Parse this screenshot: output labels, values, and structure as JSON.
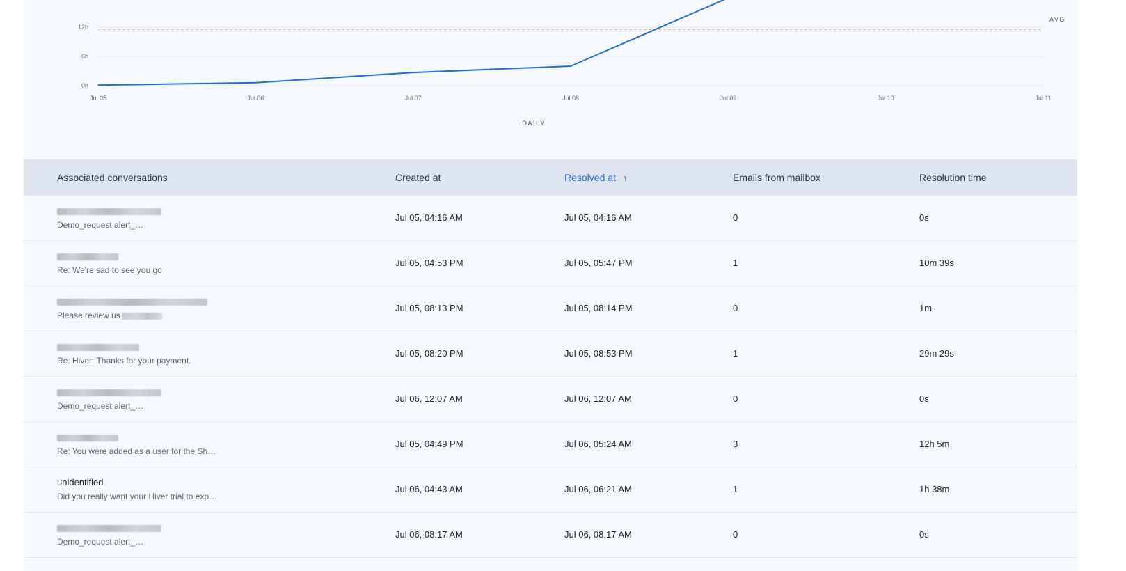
{
  "chart_data": {
    "type": "line",
    "title": "",
    "xlabel": "DAILY",
    "ylabel": "",
    "x_ticks": [
      "Jul 05",
      "Jul 06",
      "Jul 07",
      "Jul 08",
      "Jul 09",
      "Jul 10",
      "Jul 11"
    ],
    "y_ticks": [
      "0h",
      "6h",
      "12h"
    ],
    "ylim": [
      0,
      12
    ],
    "series": [
      {
        "points": [
          {
            "x": "Jul 05",
            "y": 0.1
          },
          {
            "x": "Jul 06",
            "y": 0.6
          },
          {
            "x": "Jul 07",
            "y": 2.7
          },
          {
            "x": "Jul 08",
            "y": 4.0
          },
          {
            "x": "Jul 09",
            "y": 18.0
          }
        ],
        "color": "#1e6fd6"
      }
    ],
    "avg": {
      "label": "AVG",
      "value": 11.5,
      "color": "#f2b483"
    },
    "grid": true
  },
  "table": {
    "columns": [
      {
        "label": "Associated conversations"
      },
      {
        "label": "Created at"
      },
      {
        "label": "Resolved at",
        "sort_arrow": "↑"
      },
      {
        "label": "Emails from mailbox"
      },
      {
        "label": "Resolution time"
      }
    ],
    "rows": [
      {
        "title": "",
        "subject": "Demo_request alert_",
        "created": "Jul 05, 04:16 AM",
        "resolved": "Jul 05, 04:16 AM",
        "emails": "0",
        "resolution": "0s"
      },
      {
        "title": "",
        "subject": "Re: We're sad to see you go",
        "created": "Jul 05, 04:53 PM",
        "resolved": "Jul 05, 05:47 PM",
        "emails": "1",
        "resolution": "10m 39s"
      },
      {
        "title": "",
        "subject": "Please review us",
        "created": "Jul 05, 08:13 PM",
        "resolved": "Jul 05, 08:14 PM",
        "emails": "0",
        "resolution": "1m"
      },
      {
        "title": "",
        "subject": "Re: Hiver: Thanks for your payment.",
        "created": "Jul 05, 08:20 PM",
        "resolved": "Jul 05, 08:53 PM",
        "emails": "1",
        "resolution": "29m 29s"
      },
      {
        "title": "",
        "subject": "Demo_request alert_",
        "created": "Jul 06, 12:07 AM",
        "resolved": "Jul 06, 12:07 AM",
        "emails": "0",
        "resolution": "0s"
      },
      {
        "title": "",
        "subject": "Re: You were added as a user for the Shar…",
        "created": "Jul 05, 04:49 PM",
        "resolved": "Jul 06, 05:24 AM",
        "emails": "3",
        "resolution": "12h 5m"
      },
      {
        "title": "unidentified",
        "subject": "Did you really want your Hiver trial to expi…",
        "created": "Jul 06, 04:43 AM",
        "resolved": "Jul 06, 06:21 AM",
        "emails": "1",
        "resolution": "1h 38m"
      },
      {
        "title": "",
        "subject": "Demo_request alert_",
        "created": "Jul 06, 08:17 AM",
        "resolved": "Jul 06, 08:17 AM",
        "emails": "0",
        "resolution": "0s"
      }
    ]
  }
}
